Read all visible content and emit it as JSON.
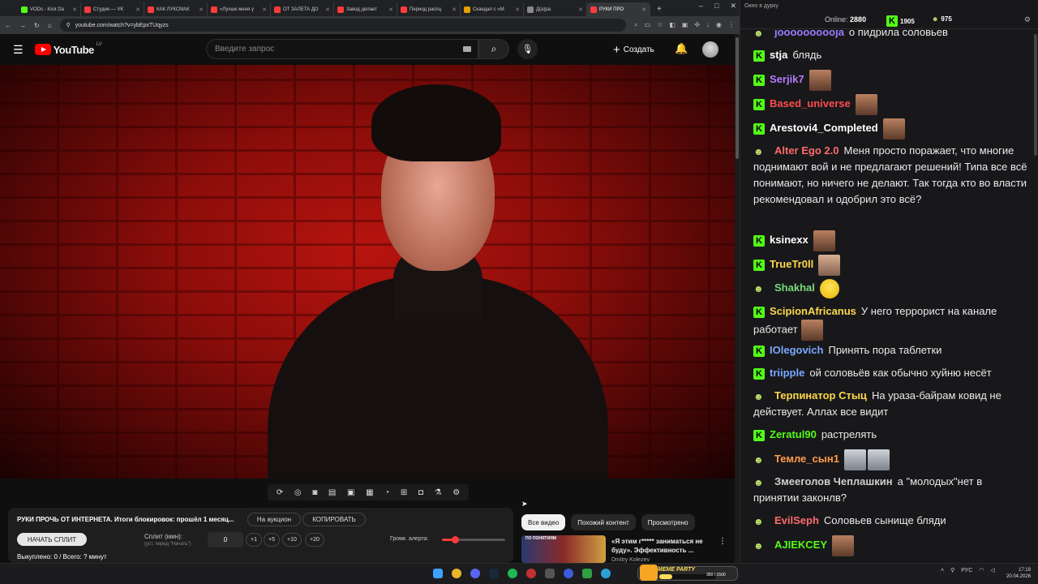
{
  "browser": {
    "tabs": [
      {
        "label": "VODs - Kick Da",
        "color": "#53fc18"
      },
      {
        "label": "Студия — VK",
        "color": "#ff3b3b"
      },
      {
        "label": "КАК ЛУКСМАК",
        "color": "#ff3b3b"
      },
      {
        "label": "«Лучше меня у",
        "color": "#ff3b3b"
      },
      {
        "label": "ОТ ЗАЛЕТА ДО",
        "color": "#ff3b3b"
      },
      {
        "label": "Завод делает",
        "color": "#ff3b3b"
      },
      {
        "label": "Период распц",
        "color": "#ff3b3b"
      },
      {
        "label": "Скандал с «М",
        "color": "#e8a000"
      },
      {
        "label": "Д(а)ра",
        "color": "#888888"
      },
      {
        "label": "РУКИ ПРО",
        "color": "#ff3b3b",
        "active": true
      }
    ],
    "url": "youtube.com/watch?v=ybEpxTUqyzs"
  },
  "youtube": {
    "logo": "YouTube",
    "region": "LV",
    "search_placeholder": "Введите запрос",
    "create_label": "Создать"
  },
  "panel": {
    "title": "РУКИ ПРОЧЬ ОТ ИНТЕРНЕТА. Итоги блокировок: прошёл 1 месяц...",
    "auction_label": "На аукцион",
    "copy_label": "КОПИРОВАТЬ",
    "start_split_label": "НАЧАТЬ СПЛИТ",
    "split_label": "Сплит (мин):",
    "split_hint": "(уст. перед \"Начать\")",
    "split_value": "0",
    "increments": [
      "+1",
      "+5",
      "+10",
      "+20"
    ],
    "alert_volume_label": "Громк. алерта:",
    "alert_volume_level": 0.2,
    "stats": "Выкуплено: 0 / Всего: ? минут"
  },
  "recs": {
    "chips": [
      "Все видео",
      "Похожий контент",
      "Просмотрено"
    ],
    "item": {
      "thumb_tag": "ПО ПОНЯТИЯМ",
      "title": "«Я этим г***** заниматься не буду». Эффективность ...",
      "channel": "Dmitry Kolezev"
    }
  },
  "chat": {
    "window_title": "Окно в дурку",
    "online_label": "Online:",
    "online_count": "2880",
    "kick_count": "1905",
    "twitch_count": "975",
    "messages": [
      {
        "platform": "twitch",
        "nick": "joooooooooja",
        "color": "#9b7bff",
        "text": "о пидрила соловьев"
      },
      {
        "platform": "kick",
        "nick": "stja",
        "color": "#ffffff",
        "text": "блядь"
      },
      {
        "platform": "kick",
        "nick": "Serjik7",
        "color": "#b57bff",
        "text": "",
        "emotes": [
          "face"
        ]
      },
      {
        "platform": "kick",
        "nick": "Based_universe",
        "color": "#ff4b4b",
        "text": "",
        "emotes": [
          "face"
        ]
      },
      {
        "platform": "kick",
        "nick": "Arestovi4_Completed",
        "color": "#ffffff",
        "text": "",
        "emotes": [
          "face"
        ]
      },
      {
        "platform": "twitch",
        "nick": "Alter Ego 2.0",
        "color": "#ff6b6b",
        "text": "Меня просто поражает, что многие поднимают вой и не предлагают решений! Типа все всё понимают, но ничего не делают. Так тогда кто во власти рекомендовал и одобрил это всё?"
      },
      {
        "platform": "kick",
        "nick": "ksinexx",
        "color": "#ffffff",
        "text": "",
        "emotes": [
          "face"
        ]
      },
      {
        "platform": "kick",
        "nick": "TrueTr0ll",
        "color": "#ffd84a",
        "text": "",
        "emotes": [
          "face2"
        ]
      },
      {
        "platform": "twitch",
        "nick": "Shakhal",
        "color": "#7bd87b",
        "text": "",
        "emotes": [
          "smile"
        ]
      },
      {
        "platform": "kick",
        "nick": "ScipionAfricanus",
        "color": "#ffd84a",
        "text": "У него террорист на канале работает",
        "emotes": [
          "face"
        ]
      },
      {
        "platform": "kick",
        "nick": "IOlegovich",
        "color": "#7ba8ff",
        "text": "Принять пора таблетки"
      },
      {
        "platform": "kick",
        "nick": "triipple",
        "color": "#7ba8ff",
        "text": "ой соловьёв как обычно хуйню несёт"
      },
      {
        "platform": "twitch",
        "nick": "Терпинатор Стыц",
        "color": "#ffd84a",
        "text": "На ураза-байрам ковид не действует. Аллах все видит"
      },
      {
        "platform": "kick",
        "nick": "Zeratul90",
        "color": "#53fc18",
        "text": "растрелять"
      },
      {
        "platform": "twitch",
        "nick": "Темле_сын1",
        "color": "#ff9b4b",
        "text": "",
        "emotes": [
          "face3",
          "face3"
        ]
      },
      {
        "platform": "twitch",
        "nick": "Змееголов Чеплашкин",
        "color": "#cfcfcf",
        "text": "а \"молодых\"нет в принятии законлв?"
      },
      {
        "platform": "twitch",
        "nick": "EvilSeph",
        "color": "#ff6b6b",
        "text": "Соловьев сынище бляди"
      },
      {
        "platform": "twitch",
        "nick": "AJIEKCEY",
        "color": "#53fc18",
        "text": "",
        "emotes": [
          "face"
        ]
      }
    ]
  },
  "taskbar": {
    "meme_party_label": "MEME PARTY",
    "meme_party_value": "350 / 1500",
    "meme_party_progress": 0.23,
    "lang": "РУС",
    "time": "17:19",
    "date": "20.04.2026"
  },
  "colors": {
    "yt_red": "#ff0000",
    "kick_green": "#53fc18"
  }
}
